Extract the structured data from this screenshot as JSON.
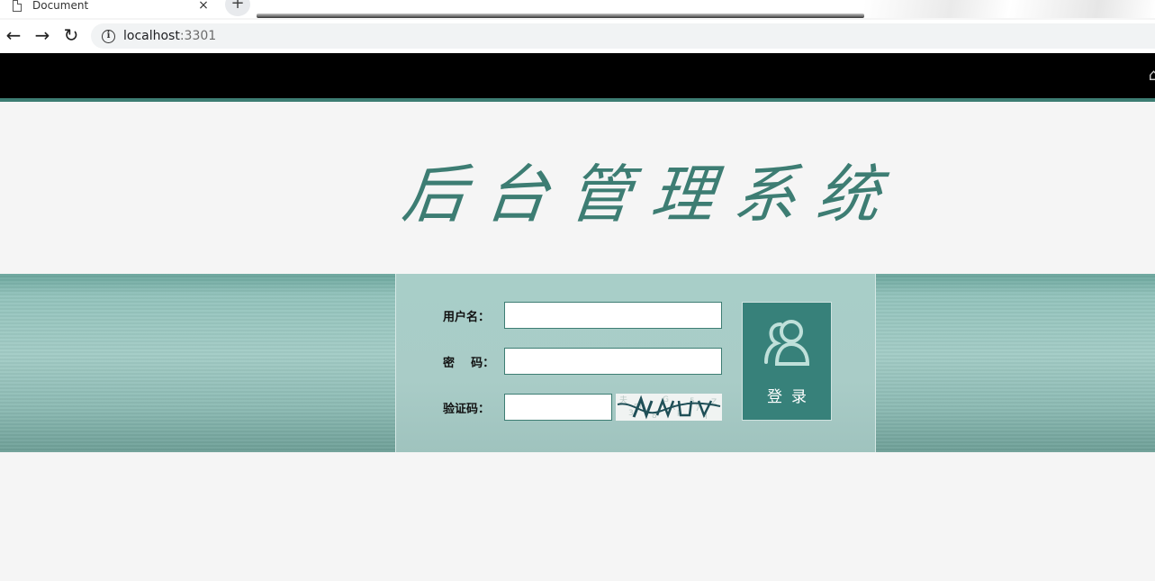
{
  "browser": {
    "tab_title": "Document",
    "tab_close": "×",
    "new_tab": "+",
    "url_host": "localhost",
    "url_port": ":3301"
  },
  "page": {
    "headline_chars": [
      "后",
      "台",
      "管",
      "理",
      "系",
      "统"
    ],
    "accent_color": "#3d7d73",
    "form": {
      "username_label": "用户名：",
      "password_label": "密    码：",
      "captcha_label": "验证码：",
      "username_value": "",
      "password_value": "",
      "captcha_value": ""
    },
    "login_button": "登录"
  }
}
